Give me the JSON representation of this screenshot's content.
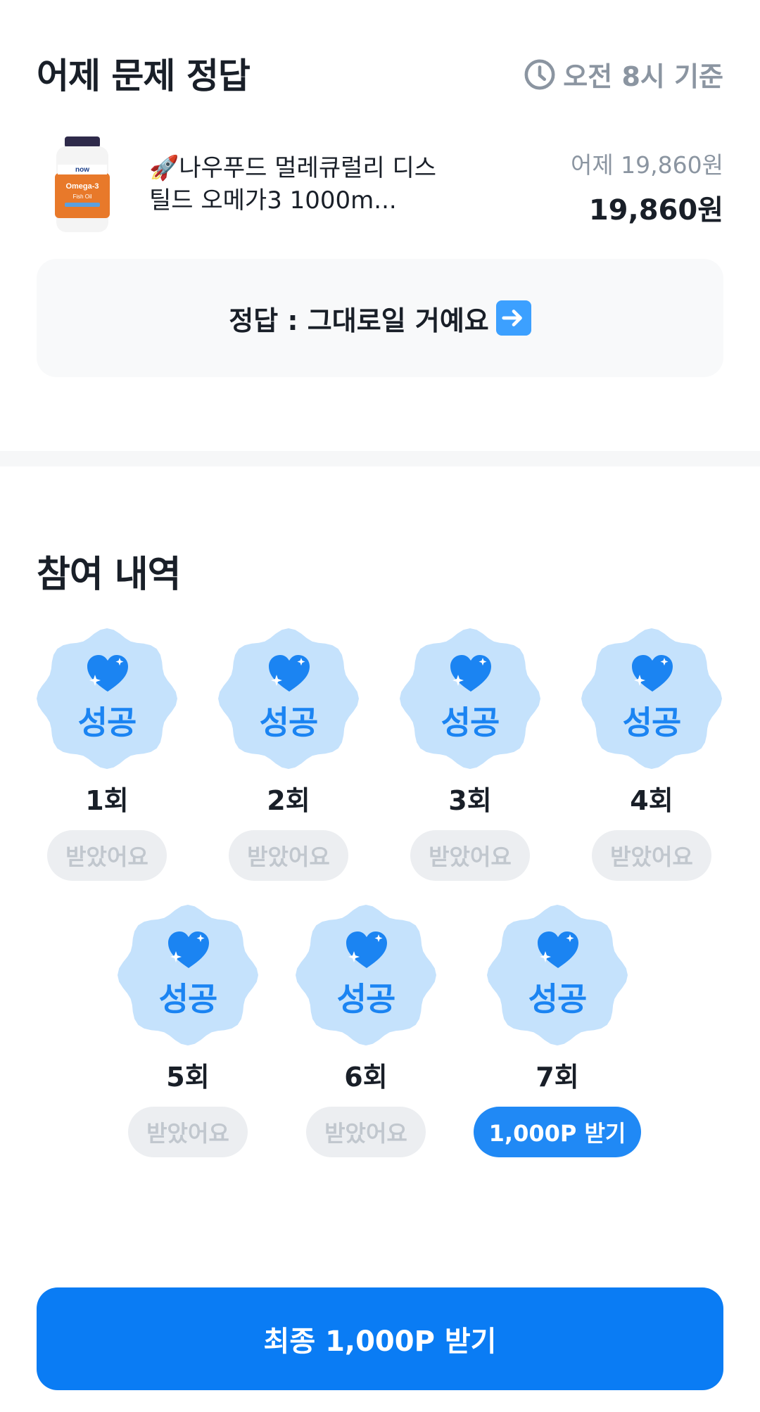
{
  "header": {
    "title": "어제 문제 정답",
    "basis_label": "오전 8시 기준",
    "basis_icon": "clock-icon"
  },
  "product": {
    "name": "🚀나우푸드 멀레큐럴리 디스틸드 오메가3 1000m...",
    "image_icon": "omega3-bottle-image",
    "price_prev": "어제 19,860원",
    "price_now": "19,860원"
  },
  "answer": {
    "text": "정답 : 그대로일 거예요",
    "icon": "right-arrow-emoji"
  },
  "history": {
    "title": "참여 내역",
    "stamp_label": "성공",
    "items": [
      {
        "count": "1회",
        "status": "받았어요",
        "active": false
      },
      {
        "count": "2회",
        "status": "받았어요",
        "active": false
      },
      {
        "count": "3회",
        "status": "받았어요",
        "active": false
      },
      {
        "count": "4회",
        "status": "받았어요",
        "active": false
      },
      {
        "count": "5회",
        "status": "받았어요",
        "active": false
      },
      {
        "count": "6회",
        "status": "받았어요",
        "active": false
      },
      {
        "count": "7회",
        "status": "1,000P 받기",
        "active": true
      }
    ]
  },
  "cta": {
    "label": "최종 1,000P 받기"
  },
  "colors": {
    "primary": "#0a7cf4",
    "stamp_bg": "#c5e2fc",
    "stamp_text": "#1b84f2",
    "muted_pill_bg": "#eceef1",
    "muted_text": "#8b95a1"
  }
}
